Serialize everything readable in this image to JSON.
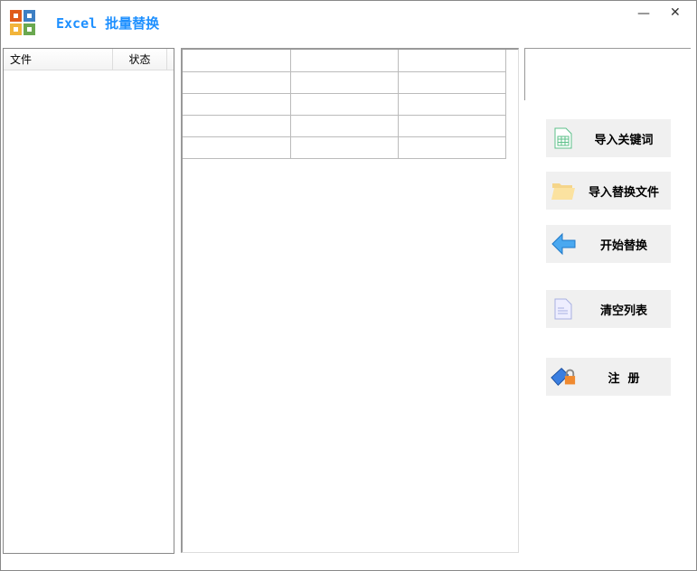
{
  "window": {
    "title": "Excel 批量替换",
    "minimize": "—",
    "close": "✕"
  },
  "file_list": {
    "columns": [
      "文件",
      "状态"
    ]
  },
  "grid": {
    "rows": [
      [
        "",
        "",
        ""
      ],
      [
        "",
        "",
        ""
      ],
      [
        "",
        "",
        ""
      ],
      [
        "",
        "",
        ""
      ],
      [
        "",
        "",
        ""
      ]
    ]
  },
  "buttons": [
    {
      "label": "导入关键词",
      "icon": "spreadsheet-icon"
    },
    {
      "label": "导入替换文件",
      "icon": "folder-icon"
    },
    {
      "label": "开始替换",
      "icon": "arrow-left-icon"
    },
    {
      "label": "清空列表",
      "icon": "document-icon"
    },
    {
      "label": "注  册",
      "icon": "lock-key-icon"
    }
  ]
}
